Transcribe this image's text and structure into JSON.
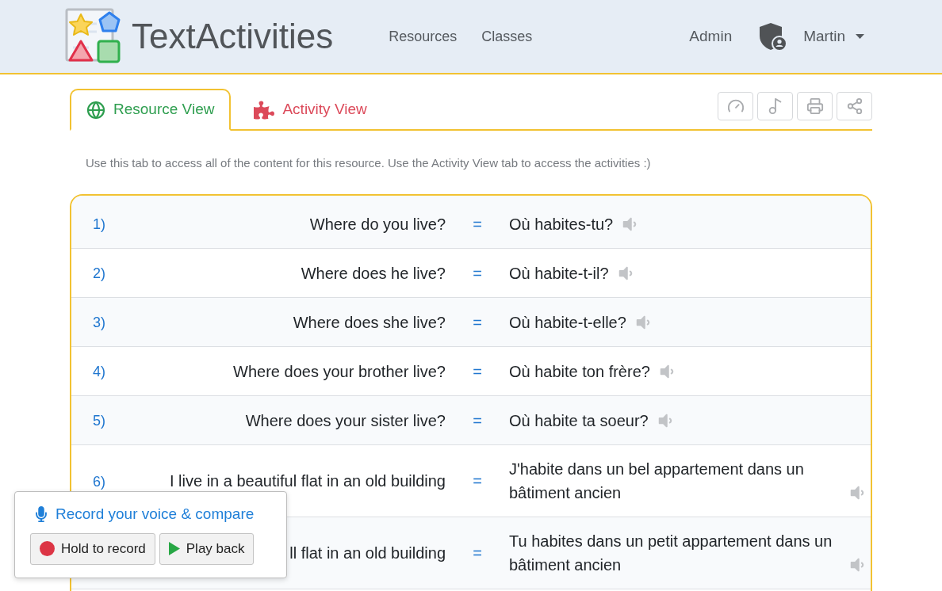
{
  "header": {
    "brand": "TextActivities",
    "nav": [
      {
        "label": "Resources"
      },
      {
        "label": "Classes"
      }
    ],
    "admin": "Admin",
    "user": "Martin"
  },
  "tabs": [
    {
      "label": "Resource View",
      "selected": true,
      "color": "#2e9e4f"
    },
    {
      "label": "Activity View",
      "selected": false,
      "color": "#dc4a5a"
    }
  ],
  "description": "Use this tab to access all of the content for this resource. Use the Activity View tab to access the activities :)",
  "rows": [
    {
      "number": "1)",
      "english": "Where do you live?",
      "equals": "=",
      "french": "Où habites-tu?"
    },
    {
      "number": "2)",
      "english": "Where does he live?",
      "equals": "=",
      "french": "Où habite-t-il?"
    },
    {
      "number": "3)",
      "english": "Where does she live?",
      "equals": "=",
      "french": "Où habite-t-elle?"
    },
    {
      "number": "4)",
      "english": "Where does your brother live?",
      "equals": "=",
      "french": "Où habite ton frère?"
    },
    {
      "number": "5)",
      "english": "Where does your sister live?",
      "equals": "=",
      "french": "Où habite ta soeur?"
    },
    {
      "number": "6)",
      "english": "I live in a beautiful flat in an old building",
      "equals": "=",
      "french": "J'habite dans un bel appartement dans un bâtiment ancien"
    },
    {
      "english": "ll flat in an old building",
      "equals": "=",
      "french": "Tu habites dans un petit appartement dans un bâtiment ancien"
    }
  ],
  "recorder": {
    "title": "Record your voice & compare",
    "buttons": [
      {
        "label": "Hold to record"
      },
      {
        "label": "Play back"
      }
    ]
  }
}
